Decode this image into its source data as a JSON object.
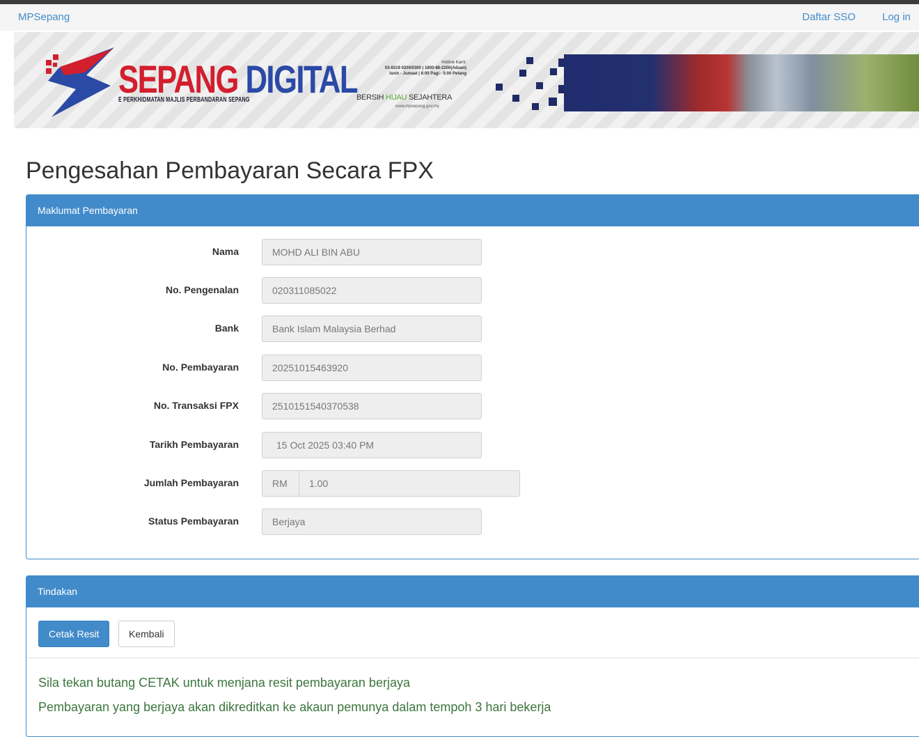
{
  "nav": {
    "brand": "MPSepang",
    "links": [
      "Daftar SSO",
      "Log in"
    ]
  },
  "banner": {
    "logo_word1": "SEPANG",
    "logo_word2": "DIGITAL",
    "logo_subtitle": "E PERKHIDMATAN MAJLIS PERBANDARAN SEPANG",
    "hotline_title": "Hotline Kami:",
    "hotline_line1": "03-8319 0200/0300 | 1800-88-2200(Aduan)",
    "hotline_line2": "Isnin - Jumaat | 8:00 Pagi - 5:00 Petang",
    "tagline_pre": "BERSIH ",
    "tagline_mid": "HIJAU",
    "tagline_post": " SEJAHTERA",
    "tagline_url": "www.mpsepang.gov.my"
  },
  "page_title": "Pengesahan Pembayaran Secara FPX",
  "payment_panel": {
    "heading": "Maklumat Pembayaran",
    "fields": [
      {
        "label": "Nama",
        "value": "MOHD ALI BIN ABU"
      },
      {
        "label": "No. Pengenalan",
        "value": "020311085022"
      },
      {
        "label": "Bank",
        "value": "Bank Islam Malaysia Berhad"
      },
      {
        "label": "No. Pembayaran",
        "value": "20251015463920"
      },
      {
        "label": "No. Transaksi FPX",
        "value": "2510151540370538"
      },
      {
        "label": "Tarikh Pembayaran",
        "value": "15 Oct 2025 03:40 PM"
      },
      {
        "label": "Jumlah Pembayaran",
        "currency": "RM",
        "value": "1.00"
      },
      {
        "label": "Status Pembayaran",
        "value": "Berjaya"
      }
    ]
  },
  "action_panel": {
    "heading": "Tindakan",
    "print_button": "Cetak Resit",
    "back_button": "Kembali",
    "messages": [
      "Sila tekan butang CETAK untuk menjana resit pembayaran berjaya",
      "Pembayaran yang berjaya akan dikreditkan ke akaun pemunya dalam tempoh 3 hari bekerja"
    ]
  },
  "colors": {
    "primary": "#428bca",
    "success_text": "#3c763d",
    "logo_red": "#d21f2e",
    "logo_blue": "#2b4aa6"
  }
}
